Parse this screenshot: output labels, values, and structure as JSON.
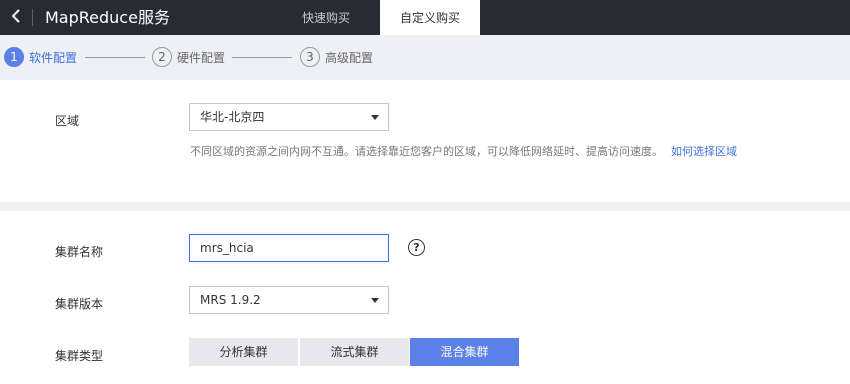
{
  "header": {
    "back_icon": "chevron-left-icon",
    "title": "MapReduce服务",
    "tabs": [
      {
        "label": "快速购买",
        "active": false
      },
      {
        "label": "自定义购买",
        "active": true
      }
    ]
  },
  "steps": [
    {
      "number": "1",
      "label": "软件配置",
      "active": true
    },
    {
      "number": "2",
      "label": "硬件配置",
      "active": false
    },
    {
      "number": "3",
      "label": "高级配置",
      "active": false
    }
  ],
  "region": {
    "label": "区域",
    "value": "华北-北京四",
    "hint": "不同区域的资源之间内网不互通。请选择靠近您客户的区域，可以降低网络延时、提高访问速度。",
    "hint_link": "如何选择区域"
  },
  "cluster": {
    "name_label": "集群名称",
    "name_value": "mrs_hcia",
    "help_icon": "?",
    "version_label": "集群版本",
    "version_value": "MRS 1.9.2",
    "type_label": "集群类型",
    "types": [
      {
        "label": "分析集群",
        "active": false
      },
      {
        "label": "流式集群",
        "active": false
      },
      {
        "label": "混合集群",
        "active": true
      }
    ]
  },
  "colors": {
    "accent": "#5b80e6",
    "header_bg": "#282b33",
    "link": "#3b6fe0"
  }
}
